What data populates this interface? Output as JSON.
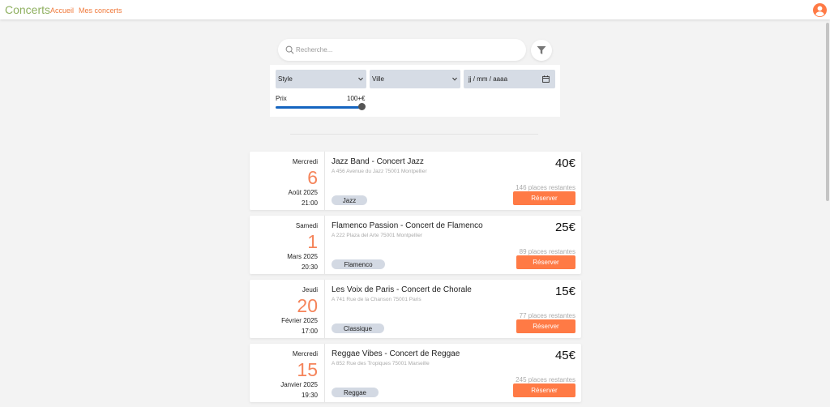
{
  "app": {
    "title": "Concerts"
  },
  "nav": {
    "home": "Accueil",
    "my_concerts": "Mes concerts"
  },
  "icons": {
    "user": "user-circle-icon",
    "search": "search-icon",
    "filter": "filter-funnel-icon",
    "calendar": "calendar-icon",
    "chevron": "chevron-down-icon"
  },
  "colors": {
    "accent": "#ff7a45",
    "brand": "#8fb060",
    "date": "#f5845a",
    "slider": "#1565c0"
  },
  "search": {
    "placeholder": "Recherche..."
  },
  "filters": {
    "style": "Style",
    "ville": "Ville",
    "date_placeholder": "jj / mm / aaaa",
    "price_label": "Prix",
    "price_value": "100+€",
    "price_level": 1.0
  },
  "concerts": [
    {
      "day": "Mercredi",
      "num": "6",
      "month": "Août 2025",
      "time": "21:00",
      "title": "Jazz Band - Concert Jazz",
      "address": "A 456 Avenue du Jazz 75001 Montpellier",
      "price": "40€",
      "places": "146 places restantes",
      "reserve": "Réserver",
      "tag": "Jazz"
    },
    {
      "day": "Samedi",
      "num": "1",
      "month": "Mars 2025",
      "time": "20:30",
      "title": "Flamenco Passion - Concert de Flamenco",
      "address": "A 222 Plaza del Arte 75001 Montpellier",
      "price": "25€",
      "places": "89 places restantes",
      "reserve": "Réserver",
      "tag": "Flamenco"
    },
    {
      "day": "Jeudi",
      "num": "20",
      "month": "Février 2025",
      "time": "17:00",
      "title": "Les Voix de Paris - Concert de Chorale",
      "address": "A 741 Rue de la Chanson 75001 Paris",
      "price": "15€",
      "places": "77 places restantes",
      "reserve": "Réserver",
      "tag": "Classique"
    },
    {
      "day": "Mercredi",
      "num": "15",
      "month": "Janvier 2025",
      "time": "19:30",
      "title": "Reggae Vibes - Concert de Reggae",
      "address": "A 852 Rue des Tropiques 75001 Marseille",
      "price": "45€",
      "places": "245 places restantes",
      "reserve": "Réserver",
      "tag": "Reggae"
    }
  ]
}
